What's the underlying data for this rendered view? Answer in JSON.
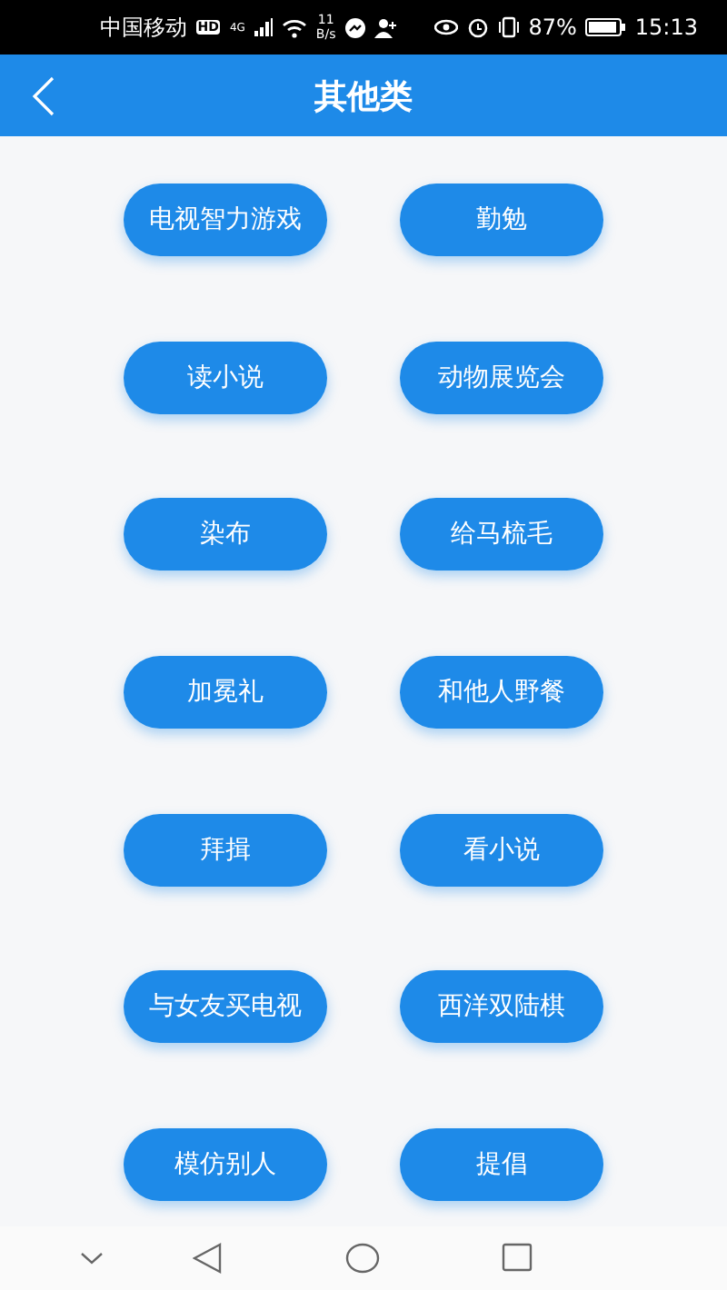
{
  "status_bar": {
    "carrier": "中国移动",
    "hd": "HD",
    "network": "4G",
    "speed_value": "11",
    "speed_unit": "B/s",
    "battery": "87%",
    "time": "15:13"
  },
  "header": {
    "title": "其他类"
  },
  "items": [
    {
      "label": "电视智力游戏"
    },
    {
      "label": "勤勉"
    },
    {
      "label": "读小说"
    },
    {
      "label": "动物展览会"
    },
    {
      "label": "染布"
    },
    {
      "label": "给马梳毛"
    },
    {
      "label": "加冕礼"
    },
    {
      "label": "和他人野餐"
    },
    {
      "label": "拜揖"
    },
    {
      "label": "看小说"
    },
    {
      "label": "与女友买电视"
    },
    {
      "label": "西洋双陆棋"
    },
    {
      "label": "模仿别人"
    },
    {
      "label": "提倡"
    }
  ]
}
